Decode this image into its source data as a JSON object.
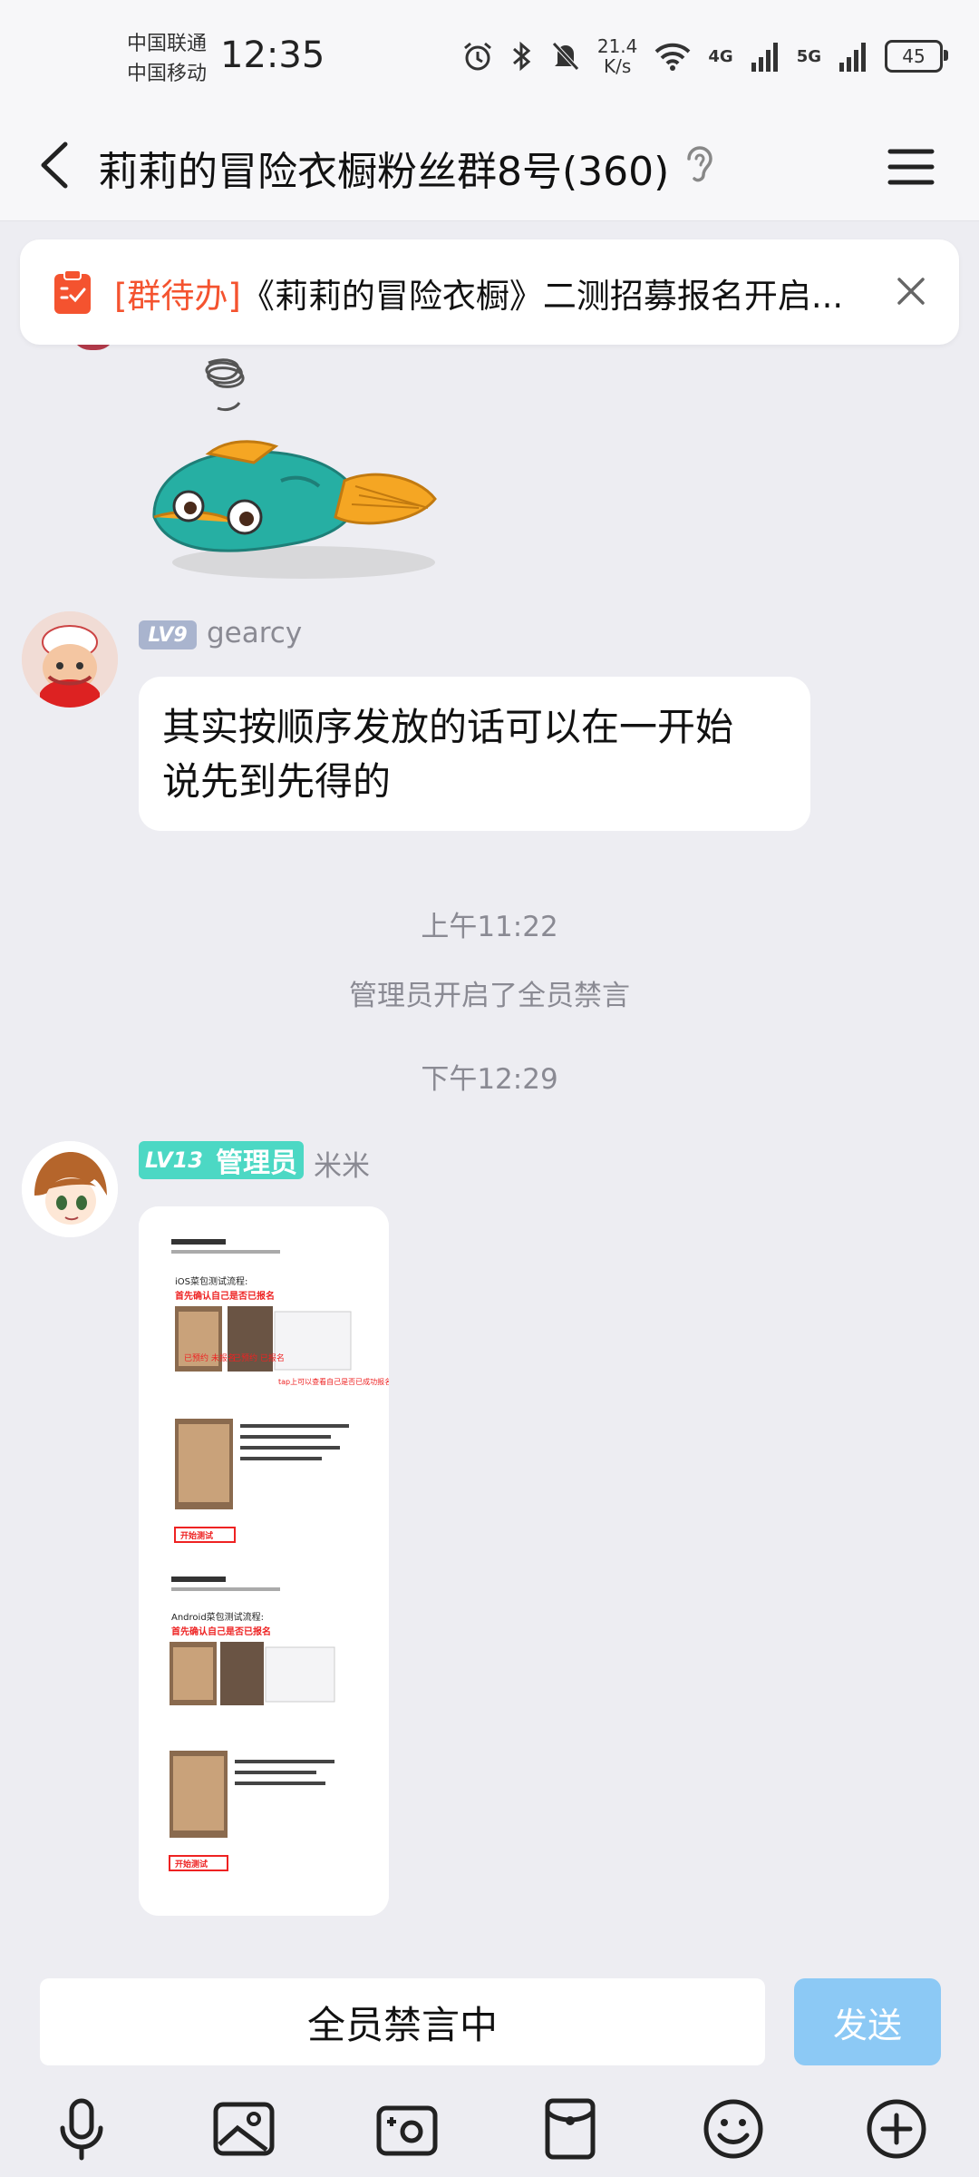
{
  "status_bar": {
    "carrier1": "中国联通",
    "carrier2": "中国移动",
    "time": "12:35",
    "speed_value": "21.4",
    "speed_unit": "K/s",
    "net1": "4G",
    "net2": "5G",
    "battery": "45"
  },
  "header": {
    "title": "莉莉的冒险衣橱粉丝群8号(360)"
  },
  "banner": {
    "tag": "[群待办]",
    "text": "《莉莉的冒险衣橱》二测招募报名开启..."
  },
  "messages": [
    {
      "level": "LV9",
      "name": "gearcy",
      "text_line1": "其实按顺序发放的话可以在一开始",
      "text_line2": "说先到先得的"
    },
    {
      "level": "LV13",
      "role": "管理员",
      "name": "米米"
    }
  ],
  "system": {
    "time1": "上午11:22",
    "notice": "管理员开启了全员禁言",
    "time2": "下午12:29"
  },
  "poster": {
    "ios_title": "iOS菜包测试流程:",
    "ios_sub": "首先确认自己是否已报名",
    "ios_tag1": "已预约 未报名",
    "ios_tag2": "已预约 已报名",
    "ios_tap": "tap上可以查看自己是否已成功报名",
    "ios_btn": "开始测试",
    "android_title": "Android菜包测试流程:",
    "android_sub": "首先确认自己是否已报名",
    "android_btn": "开始测试"
  },
  "input": {
    "muted_text": "全员禁言中",
    "send_label": "发送"
  },
  "colors": {
    "accent_red": "#F4532F",
    "send_disabled": "#8CC9F5",
    "admin_badge": "#4CD8C4",
    "lv9_badge": "#A9B4CE",
    "chat_bg": "#EDEDF2"
  }
}
